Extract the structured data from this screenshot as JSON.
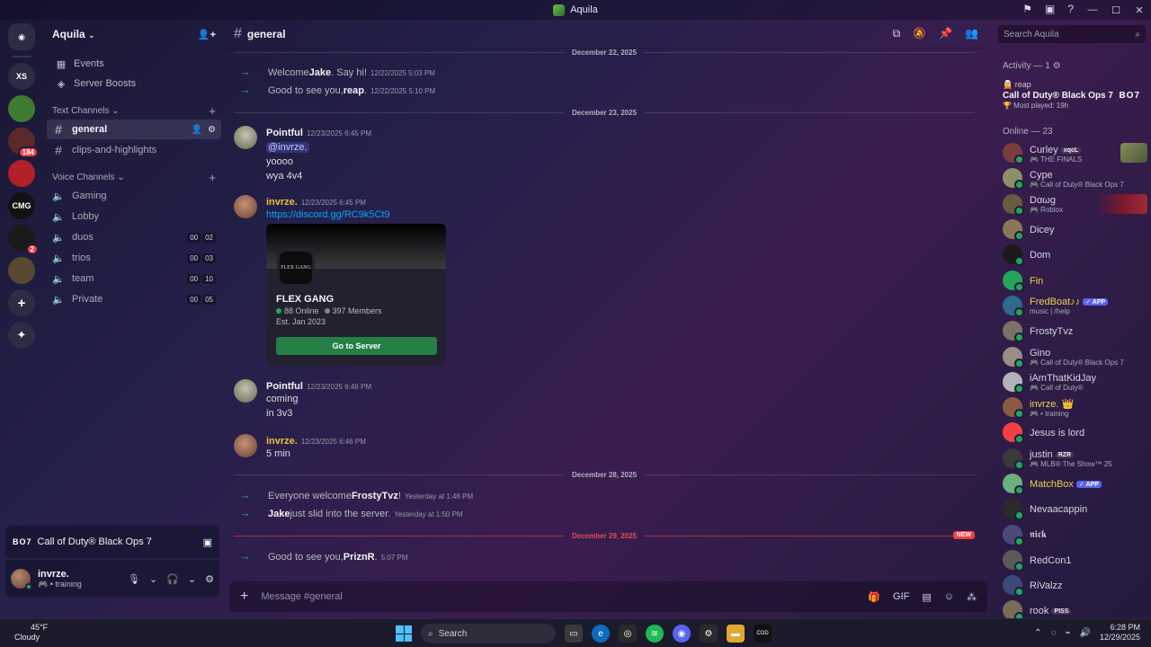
{
  "window": {
    "title": "Aquila",
    "minimize": "—",
    "maximize": "☐",
    "close": "✕"
  },
  "rail": {
    "servers": [
      {
        "label": "XS",
        "color": "#2b2d43"
      },
      {
        "label": "",
        "color": "#3f7b33"
      },
      {
        "label": "",
        "color": "#5a2a2a",
        "badge": "184"
      },
      {
        "label": "",
        "color": "#b2202a"
      },
      {
        "label": "CMG",
        "color": "#121212"
      },
      {
        "label": "",
        "color": "#1a1a1a",
        "badge": "2"
      },
      {
        "label": "",
        "color": "#5a4830"
      }
    ]
  },
  "server": {
    "name": "Aquila",
    "events": "Events",
    "boosts": "Server Boosts"
  },
  "text_category": "Text Channels",
  "text_channels": [
    "general",
    "clips-and-highlights"
  ],
  "voice_category": "Voice Channels",
  "voice_channels": [
    {
      "name": "Gaming",
      "a": "",
      "b": ""
    },
    {
      "name": "Lobby",
      "a": "",
      "b": ""
    },
    {
      "name": "duos",
      "a": "00",
      "b": "02"
    },
    {
      "name": "trios",
      "a": "00",
      "b": "03"
    },
    {
      "name": "team",
      "a": "00",
      "b": "10"
    },
    {
      "name": "Private",
      "a": "00",
      "b": "05"
    }
  ],
  "activity": {
    "logo": "BO7",
    "game": "Call of Duty® Black Ops 7"
  },
  "user": {
    "name": "invrze.",
    "status": "🎮 • training"
  },
  "channel": {
    "name": "general"
  },
  "search": {
    "placeholder": "Search Aquila"
  },
  "messages": {
    "d1": "December 22, 2025",
    "s1_pre": "Welcome ",
    "s1_name": "Jake",
    "s1_post": ". Say hi!",
    "s1_ts": "12/22/2025 5:03 PM",
    "s2_pre": "Good to see you, ",
    "s2_name": "reap",
    "s2_post": ".",
    "s2_ts": "12/22/2025 5:10 PM",
    "d2": "December 23, 2025",
    "m1_author": "Pointful",
    "m1_ts": "12/23/2025 6:45 PM",
    "m1_l1": "@invrze.",
    "m1_l2": "yoooo",
    "m1_l3": "wya 4v4",
    "m2_author": "invrze.",
    "m2_ts": "12/23/2025 6:45 PM",
    "m2_link": "https://discord.gg/RC9k5Ct9",
    "invite_icon": "FLEX GANG",
    "invite_name": "FLEX GANG",
    "invite_online": "88 Online",
    "invite_members": "397 Members",
    "invite_est": "Est. Jan 2023",
    "invite_button": "Go to Server",
    "m3_author": "Pointful",
    "m3_ts": "12/23/2025 6:46 PM",
    "m3_l1": "coming",
    "m3_l2": "in 3v3",
    "m4_author": "invrze.",
    "m4_ts": "12/23/2025 6:46 PM",
    "m4_l1": "5 min",
    "d3": "December 28, 2025",
    "s3_pre": "Everyone welcome ",
    "s3_name": "FrostyTvz",
    "s3_post": "!",
    "s3_ts": "Yesterday at 1:46 PM",
    "s4_name": "Jake",
    "s4_post": " just slid into the server.",
    "s4_ts": "Yesterday at 1:50 PM",
    "d4": "December 29, 2025",
    "new": "NEW",
    "s5_pre": "Good to see you, ",
    "s5_name": "PriznR",
    "s5_post": ".",
    "s5_ts": "5:07 PM"
  },
  "composer": {
    "placeholder": "Message #general"
  },
  "members": {
    "activity_header": "Activity — 1",
    "act_user": "reap",
    "act_game": "Call of Duty® Black Ops 7",
    "act_played": "🏆 Most played: 19h",
    "act_logo": "BO7",
    "online_header": "Online — 23",
    "list": [
      {
        "name": "Curley",
        "tag": "xqcL",
        "sub": "🎮 THE FINALS",
        "color": "#7a3d3d"
      },
      {
        "name": "Cype",
        "sub": "🎮 Call of Duty® Black Ops 7",
        "color": "#8c8f6a"
      },
      {
        "name": "Dαωg",
        "sub": "🎮 Roblox",
        "color": "#6a5a3f"
      },
      {
        "name": "Dicey",
        "sub": "",
        "color": "#8a7658"
      },
      {
        "name": "Dom",
        "sub": "",
        "color": "#1a1a1a"
      },
      {
        "name": "Fin",
        "sub": "",
        "color": "#23a55a",
        "yellow": true
      },
      {
        "name": "FredBoat♪♪",
        "tag": "✓ APP",
        "app": true,
        "sub": "music | /help",
        "color": "#2e6a8e",
        "yellow": true
      },
      {
        "name": "FrostyTvz",
        "sub": "",
        "color": "#7a7266"
      },
      {
        "name": "Gino",
        "sub": "🎮 Call of Duty® Black Ops 7",
        "color": "#9c8d84"
      },
      {
        "name": "iAmThatKidJay",
        "sub": "🎮 Call of Duty®",
        "color": "#b0b3b8"
      },
      {
        "name": "invrze. 👑",
        "sub": "🎮 • training",
        "color": "#8a5a45",
        "yellow": true
      },
      {
        "name": "Jesus is lord",
        "sub": "",
        "color": "#f23f43"
      },
      {
        "name": "justin",
        "tag": "RZR",
        "sub": "🎮 MLB® The Show™ 25",
        "color": "#3a3a3a"
      },
      {
        "name": "MatchBox",
        "tag": "✓ APP",
        "app": true,
        "sub": "",
        "color": "#6bb07f",
        "yellow": true
      },
      {
        "name": "Nevaacappin",
        "sub": "",
        "color": "#2a2a2a"
      },
      {
        "name": "𝖓𝖎𝖈𝖐",
        "sub": "",
        "color": "#4a4a7a"
      },
      {
        "name": "RedCon1",
        "sub": "",
        "color": "#5a5a5a"
      },
      {
        "name": "RiValzz",
        "sub": "",
        "color": "#3a4a7a"
      },
      {
        "name": "rook",
        "tag": "PISS",
        "sub": "",
        "color": "#7a6a5a"
      }
    ]
  },
  "taskbar": {
    "temp": "45°F",
    "weather": "Cloudy",
    "search": "Search",
    "time": "6:28 PM",
    "date": "12/29/2025"
  }
}
